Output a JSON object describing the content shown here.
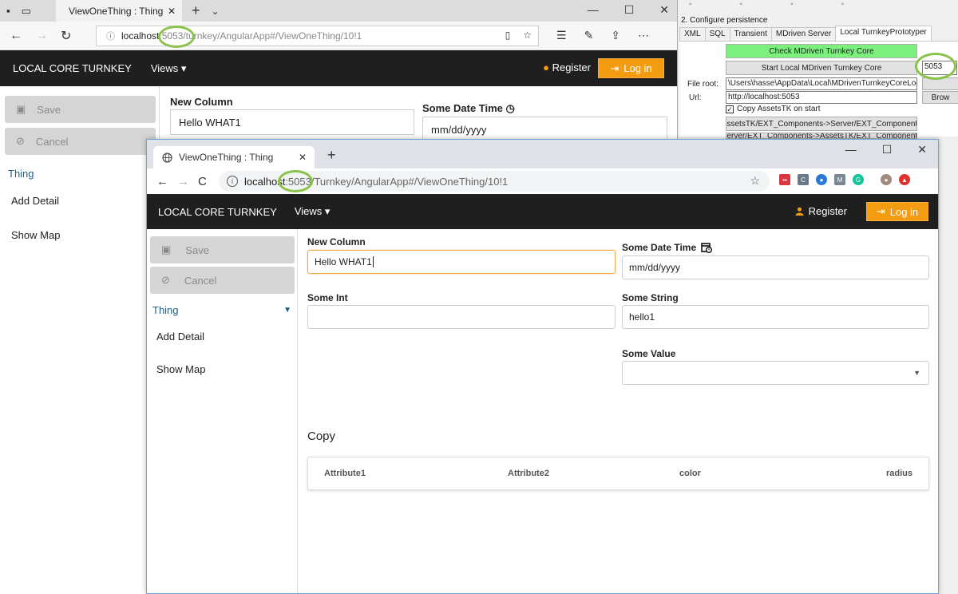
{
  "dialog": {
    "heading": "2. Configure persistence",
    "tabs": [
      "XML",
      "SQL",
      "Transient",
      "MDriven Server",
      "Local TurnkeyPrototyper"
    ],
    "active_tab": "Local TurnkeyPrototyper",
    "check_button": "Check MDriven Turnkey Core",
    "start_button": "Start Local MDriven Turnkey Core",
    "port_value": "5053",
    "file_root_label": "File root:",
    "file_root_value": "\\Users\\hasse\\AppData\\Local\\MDrivenTurnkeyCoreLocal\\",
    "url_label": "Url:",
    "url_value": "http://localhost:5053",
    "browse_label": "Brow",
    "copy_assets_label": "Copy AssetsTK on start",
    "assets_to_server_button": "AssetsTK/EXT_Components->Server/EXT_Components",
    "server_to_assets_button": "Server/EXT_Components->AssetsTK/EXT_Components"
  },
  "edge": {
    "tab_title": "ViewOneThing : Thing",
    "url_host": "localhost",
    "url_port_path": ":5053/turnkey/AngularApp#/ViewOneThing/10!1",
    "brand": "LOCAL CORE TURNKEY",
    "views_label": "Views",
    "register_label": "Register",
    "login_label": "Log in",
    "save_label": "Save",
    "cancel_label": "Cancel",
    "section_label": "Thing",
    "add_detail_label": "Add Detail",
    "show_map_label": "Show Map",
    "new_column_label": "New Column",
    "new_column_value": "Hello WHAT1",
    "date_label": "Some Date Time",
    "date_placeholder": "mm/dd/yyyy"
  },
  "chrome": {
    "tab_title": "ViewOneThing : Thing",
    "url_host": "localhost",
    "url_port": ":5053",
    "url_path": "/Turnkey/AngularApp#/ViewOneThing/10!1",
    "brand": "LOCAL CORE TURNKEY",
    "views_label": "Views",
    "register_label": "Register",
    "login_label": "Log in",
    "sidebar": {
      "save_label": "Save",
      "cancel_label": "Cancel",
      "section_label": "Thing",
      "add_detail_label": "Add Detail",
      "show_map_label": "Show Map"
    },
    "form": {
      "new_column_label": "New Column",
      "new_column_value": "Hello WHAT1",
      "date_label": "Some Date Time",
      "date_placeholder": "mm/dd/yyyy",
      "some_int_label": "Some Int",
      "some_int_value": "",
      "some_string_label": "Some String",
      "some_string_value": "hello1",
      "some_value_label": "Some Value",
      "some_value_selected": ""
    },
    "copy": {
      "title": "Copy",
      "columns": [
        "Attribute1",
        "Attribute2",
        "color",
        "radius"
      ]
    }
  },
  "colors": {
    "appbar": "#1f1f1f",
    "login_button": "#f39c12",
    "section_blue": "#1f5e82",
    "highlight_ring": "#8bc34a",
    "check_button_green": "#7cf07c"
  }
}
